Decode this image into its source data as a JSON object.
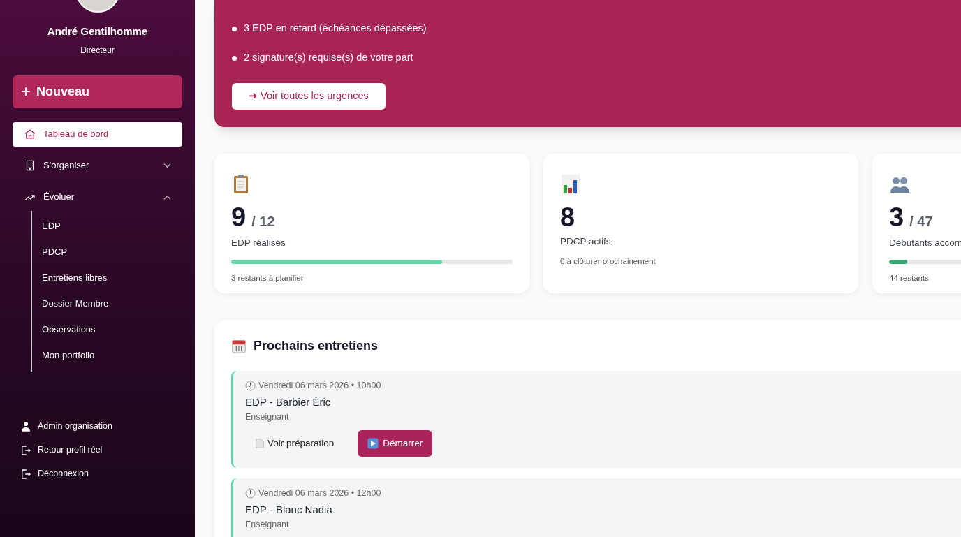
{
  "sidebar": {
    "user": {
      "name": "André Gentilhomme",
      "role": "Directeur"
    },
    "new_button": {
      "icon_text": "+",
      "label": "Nouveau"
    },
    "nav": [
      {
        "label": "Tableau de bord",
        "selected": true
      },
      {
        "label": "S'organiser",
        "selected": false,
        "expanded": false
      },
      {
        "label": "Évoluer",
        "selected": false,
        "expanded": true,
        "children": [
          {
            "label": "EDP"
          },
          {
            "label": "PDCP"
          },
          {
            "label": "Entretiens libres"
          },
          {
            "label": "Dossier Membre"
          },
          {
            "label": "Observations"
          },
          {
            "label": "Mon portfolio"
          }
        ]
      }
    ],
    "footer_links": [
      {
        "label": "Admin organisation"
      },
      {
        "label": "Retour profil réel"
      },
      {
        "label": "Déconnexion"
      }
    ]
  },
  "alerts": {
    "items": [
      "3 EDP en retard (échéances dépassées)",
      "2 signature(s) requise(s) de votre part"
    ],
    "button": "➜ Voir toutes les urgences"
  },
  "stats": [
    {
      "value": "9",
      "total": "/ 12",
      "label": "EDP réalisés",
      "level": 0.75,
      "note": "3 restants à planifier"
    },
    {
      "value": "8",
      "label": "PDCP actifs",
      "note": "0 à clôturer prochainement"
    },
    {
      "value": "3",
      "total": "/ 47",
      "label": "Débutants accom",
      "level": 0.064,
      "note": "44 restants"
    }
  ],
  "appointments": {
    "title": "Prochains entretiens",
    "items": [
      {
        "when": "Vendredi 06 mars 2026 • 10h00",
        "title": "EDP - Barbier Éric",
        "role": "Enseignant",
        "actions": [
          {
            "kind": "link",
            "label": "Voir préparation"
          },
          {
            "kind": "primary",
            "label": "Démarrer"
          }
        ]
      },
      {
        "when": "Vendredi 06 mars 2026 • 12h00",
        "title": "EDP - Blanc Nadia",
        "role": "Enseignant"
      }
    ]
  }
}
